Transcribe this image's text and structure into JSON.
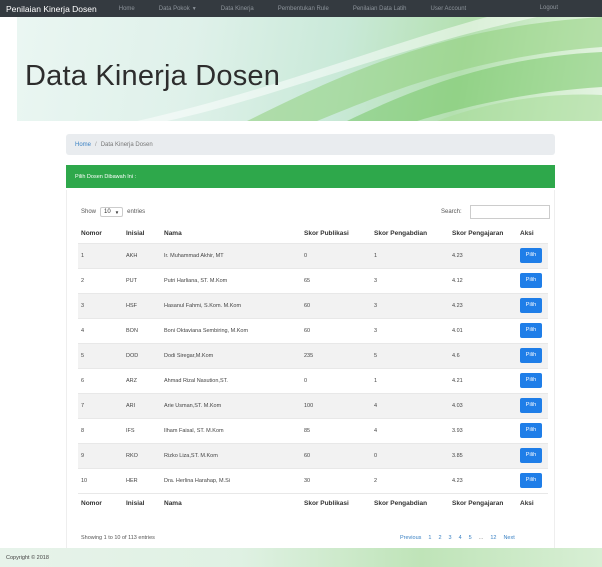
{
  "navbar": {
    "brand": "Penilaian Kinerja Dosen",
    "items": [
      "Home",
      "Data Pokok",
      "Data Kinerja",
      "Pembentukan Rule",
      "Penilaian Data Latih",
      "User Account"
    ],
    "logout": "Logout"
  },
  "hero": {
    "title": "Data Kinerja Dosen"
  },
  "breadcrumb": {
    "home": "Home",
    "separator": "/",
    "current": "Data Kinerja Dosen"
  },
  "alert": {
    "text": "Pilih Dosen Dibawah Ini :"
  },
  "table_controls": {
    "show_label": "Show",
    "length_value": "10",
    "entries_label": "entries",
    "search_label": "Search:",
    "search_value": ""
  },
  "table": {
    "headers": [
      "Nomor",
      "Inisial",
      "Nama",
      "Skor Publikasi",
      "Skor Pengabdian",
      "Skor Pengajaran",
      "Aksi"
    ],
    "rows": [
      [
        "1",
        "AKH",
        "Ir. Muhammad Akhir, MT",
        "0",
        "1",
        "4.23"
      ],
      [
        "2",
        "PUT",
        "Putri Harliana, ST. M.Kom",
        "65",
        "3",
        "4.12"
      ],
      [
        "3",
        "HSF",
        "Hasanul Fahmi, S.Kom. M.Kom",
        "60",
        "3",
        "4.23"
      ],
      [
        "4",
        "BON",
        "Boni Oktaviana Sembiring, M.Kom",
        "60",
        "3",
        "4.01"
      ],
      [
        "5",
        "DOD",
        "Dodi Siregar,M.Kom",
        "235",
        "5",
        "4.6"
      ],
      [
        "6",
        "ARZ",
        "Ahmad Rizal Nasution,ST.",
        "0",
        "1",
        "4.21"
      ],
      [
        "7",
        "ARI",
        "Arie Usman,ST. M.Kom",
        "100",
        "4",
        "4.03"
      ],
      [
        "8",
        "IFS",
        "Ilham Faisal, ST. M.Kom",
        "85",
        "4",
        "3.93"
      ],
      [
        "9",
        "RKO",
        "Rizko Liza,ST. M.Kom",
        "60",
        "0",
        "3.85"
      ],
      [
        "10",
        "HER",
        "Dra. Herlina Harahap, M.Si",
        "30",
        "2",
        "4.23"
      ]
    ],
    "action_label": "Pilih"
  },
  "info": "Showing 1 to 10 of 113 entries",
  "pagination": {
    "previous": "Previous",
    "pages": [
      "1",
      "2",
      "3",
      "4",
      "5"
    ],
    "ellipsis": "...",
    "last": "12",
    "next": "Next"
  },
  "footer": {
    "text": "Copyright © 2018"
  },
  "colors": {
    "navbar": "#343a40",
    "alert": "#2ea84b",
    "button": "#1f7ee8",
    "link": "#3b82c4"
  }
}
